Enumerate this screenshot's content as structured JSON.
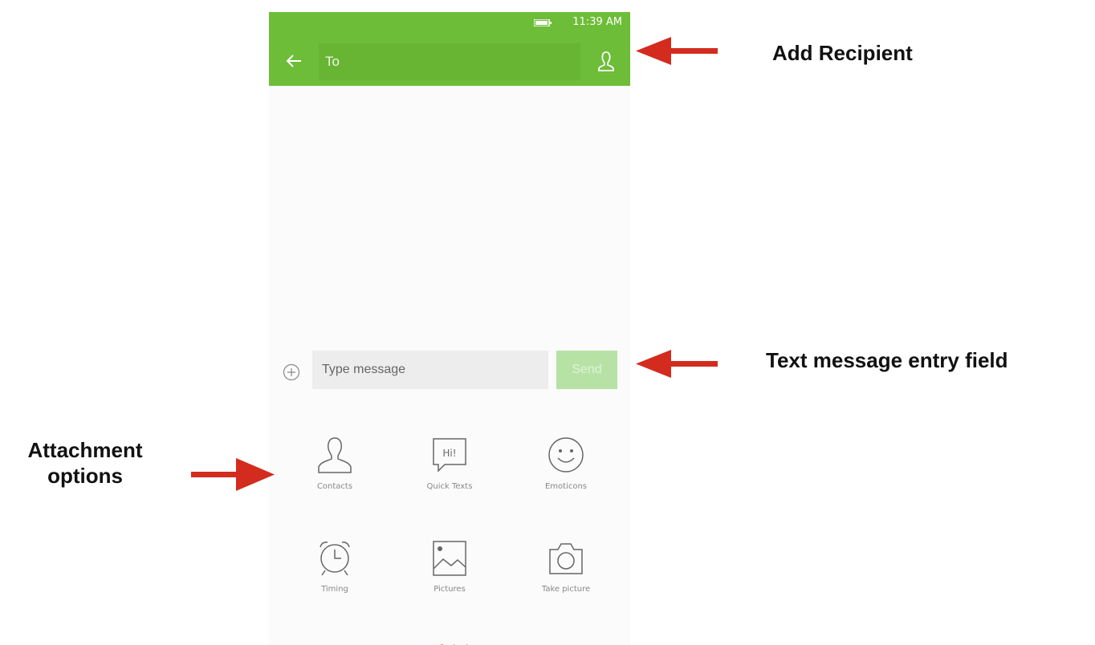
{
  "status": {
    "time": "11:39 AM"
  },
  "header": {
    "to_label": "To"
  },
  "composer": {
    "placeholder": "Type message",
    "send_label": "Send"
  },
  "attachments": [
    {
      "label": "Contacts",
      "icon": "contacts-icon"
    },
    {
      "label": "Quick Texts",
      "icon": "quick-texts-icon"
    },
    {
      "label": "Emoticons",
      "icon": "emoticons-icon"
    },
    {
      "label": "Timing",
      "icon": "timing-icon"
    },
    {
      "label": "Pictures",
      "icon": "pictures-icon"
    },
    {
      "label": "Take picture",
      "icon": "camera-icon"
    }
  ],
  "pager": {
    "pages": 3,
    "active": 1
  },
  "annotations": {
    "add_recipient": "Add Recipient",
    "text_entry": "Text message entry field",
    "attachment_line1": "Attachment",
    "attachment_line2": "options"
  },
  "colors": {
    "accent": "#6dbd38",
    "arrow": "#d32b1e",
    "send_disabled": "#b7e2a6",
    "pager_active": "#f39a2b"
  }
}
